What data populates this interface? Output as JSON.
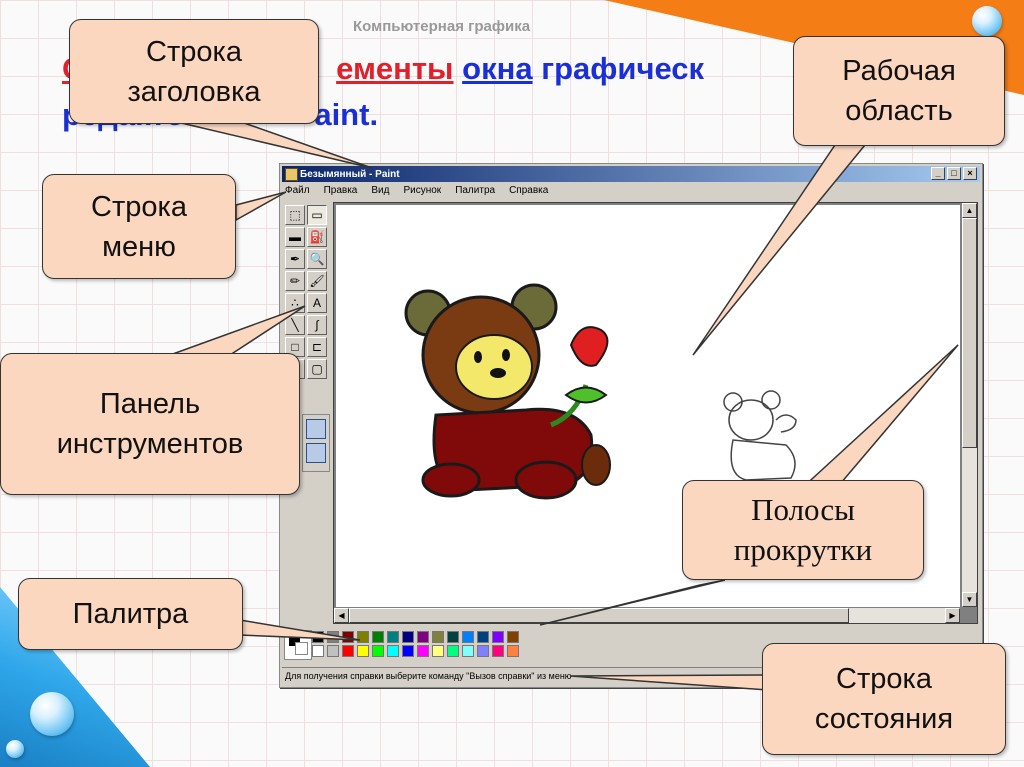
{
  "slide": {
    "ribbon_label": "Компьютерная графика",
    "title_visible_parts": {
      "red_fragment": "О",
      "red_elements": "ементы",
      "window": "окна",
      "graphic": "графическ",
      "line2a": "редакто",
      "line2b": "aint."
    }
  },
  "window": {
    "title": "Безымянный - Paint",
    "min_label": "_",
    "max_label": "□",
    "close_label": "×",
    "menu": [
      "Файл",
      "Правка",
      "Вид",
      "Рисунок",
      "Палитра",
      "Справка"
    ],
    "status_text": "Для получения справки выберите команду \"Вызов справки\" из меню"
  },
  "tools": [
    {
      "icon": "free-select-icon",
      "glyph": "⬚"
    },
    {
      "icon": "rect-select-icon",
      "glyph": "▭"
    },
    {
      "icon": "eraser-icon",
      "glyph": "▬"
    },
    {
      "icon": "fill-icon",
      "glyph": "⛽"
    },
    {
      "icon": "pick-color-icon",
      "glyph": "✒"
    },
    {
      "icon": "magnifier-icon",
      "glyph": "🔍"
    },
    {
      "icon": "pencil-icon",
      "glyph": "✏"
    },
    {
      "icon": "brush-icon",
      "glyph": "🖌"
    },
    {
      "icon": "airbrush-icon",
      "glyph": "∴"
    },
    {
      "icon": "text-icon",
      "glyph": "A"
    },
    {
      "icon": "line-icon",
      "glyph": "╲"
    },
    {
      "icon": "curve-icon",
      "glyph": "∫"
    },
    {
      "icon": "rectangle-icon",
      "glyph": "□"
    },
    {
      "icon": "polygon-icon",
      "glyph": "⊏"
    },
    {
      "icon": "ellipse-icon",
      "glyph": "○"
    },
    {
      "icon": "rounded-rect-icon",
      "glyph": "▢"
    }
  ],
  "palette_colors": {
    "row1": [
      "#000000",
      "#808080",
      "#800000",
      "#808000",
      "#008000",
      "#008080",
      "#000080",
      "#800080",
      "#808040",
      "#004040",
      "#0080ff",
      "#004080",
      "#8000ff",
      "#804000"
    ],
    "row2": [
      "#ffffff",
      "#c0c0c0",
      "#ff0000",
      "#ffff00",
      "#00ff00",
      "#00ffff",
      "#0000ff",
      "#ff00ff",
      "#ffff80",
      "#00ff80",
      "#80ffff",
      "#8080ff",
      "#ff0080",
      "#ff8040"
    ]
  },
  "callouts": {
    "title_bar": "Строка заголовка",
    "work_area": "Рабочая область",
    "menu_bar": "Строка меню",
    "toolbox": "Панель инструментов",
    "scrollbars": "Полосы прокрутки",
    "palette": "Палитра",
    "status_bar": "Строка состояния"
  },
  "colors": {
    "callout_fill": "#fbd7c0",
    "title_blue": "#1a2fd6",
    "title_red": "#e0202a",
    "win_title": "#0a246a"
  }
}
